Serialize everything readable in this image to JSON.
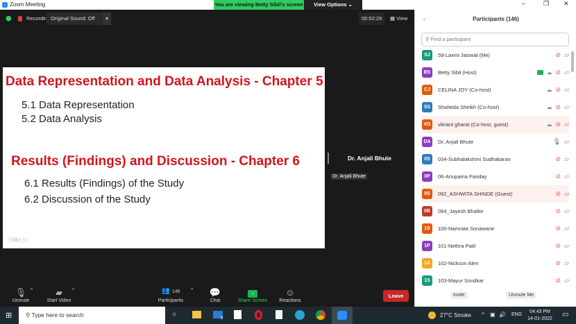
{
  "window": {
    "title": "Zoom Meeting",
    "banner": "You are viewing Betty Sibil's screen",
    "view_options": "View Options ⌄"
  },
  "top": {
    "recording": "Recording",
    "original_sound": "Original Sound: Off",
    "timer": "00:52:29",
    "view": "View"
  },
  "slide": {
    "h1": "Data Representation and Data Analysis - Chapter 5",
    "items1": [
      "5.1 Data Representation",
      "5.2 Data Analysis"
    ],
    "h2": "Results (Findings) and Discussion - Chapter 6",
    "items2": [
      "6.1 Results (Findings) of the Study",
      "6.2 Discussion of the Study"
    ],
    "page": "13"
  },
  "speaker": {
    "name": "Dr. Anjali Bhute",
    "tag": "Dr. Anjali Bhute"
  },
  "toolbar": {
    "unmute": "Unmute",
    "start_video": "Start Video",
    "participants": "Participants",
    "participants_count": "146",
    "chat": "Chat",
    "share": "Share Screen",
    "reactions": "Reactions",
    "leave": "Leave"
  },
  "panel": {
    "title": "Participants (146)",
    "search_placeholder": "Find a participant",
    "invite": "Invite",
    "unmute_me": "Unmute Me",
    "participants": [
      {
        "initials": "SJ",
        "name": "59-Laxmi Jaiswal (Me)",
        "color": "#1a9a7e",
        "cloud": false,
        "share": false,
        "mic": "muted"
      },
      {
        "initials": "BS",
        "name": "Betty Sibil (Host)",
        "color": "#8b3fbf",
        "cloud": true,
        "share": true,
        "mic": "muted"
      },
      {
        "initials": "CJ",
        "name": "CELINA JOY (Co-host)",
        "color": "#e05a10",
        "cloud": true,
        "share": false,
        "mic": "muted"
      },
      {
        "initials": "SS",
        "name": "Shaheda Sheikh (Co-host)",
        "color": "#2d7bbf",
        "cloud": true,
        "share": false,
        "mic": "muted"
      },
      {
        "initials": "VG",
        "name": "vikrant gharat (Co-host, guest)",
        "color": "#e05a10",
        "cloud": true,
        "share": false,
        "mic": "muted",
        "hl": true
      },
      {
        "initials": "DA",
        "name": "Dr. Anjali Bhute",
        "color": "#8b3fbf",
        "cloud": false,
        "share": false,
        "mic": "on"
      },
      {
        "initials": "0S",
        "name": "034-Subhalakshmi Sudhakaran",
        "color": "#2d7bbf",
        "cloud": false,
        "share": false,
        "mic": "muted"
      },
      {
        "initials": "0P",
        "name": "06-Anupama Panday",
        "color": "#8b3fbf",
        "cloud": false,
        "share": false,
        "mic": "muted"
      },
      {
        "initials": "0S",
        "name": "092_ASHWITA SHINDE (Guest)",
        "color": "#e05a10",
        "cloud": false,
        "share": false,
        "mic": "muted",
        "hl": true
      },
      {
        "initials": "0B",
        "name": "094_Jayesh Bhalke",
        "color": "#c0392b",
        "cloud": false,
        "share": false,
        "mic": "muted"
      },
      {
        "initials": "1S",
        "name": "100-Namrata Sonawane",
        "color": "#e05a10",
        "cloud": false,
        "share": false,
        "mic": "muted"
      },
      {
        "initials": "1P",
        "name": "101-Nethra Patil",
        "color": "#8b3fbf",
        "cloud": false,
        "share": false,
        "mic": "muted"
      },
      {
        "initials": "1A",
        "name": "102-Nickson Alen",
        "color": "#f5a623",
        "cloud": false,
        "share": false,
        "mic": "muted"
      },
      {
        "initials": "1S",
        "name": "103-Mayur Sondkar",
        "color": "#1a9a7e",
        "cloud": false,
        "share": false,
        "mic": "muted"
      }
    ]
  },
  "taskbar": {
    "search": "Type here to search",
    "weather": "27°C  Smoke",
    "lang": "ENG",
    "time": "04:43 PM",
    "date": "14-01-2022",
    "mail_badge": "8"
  }
}
